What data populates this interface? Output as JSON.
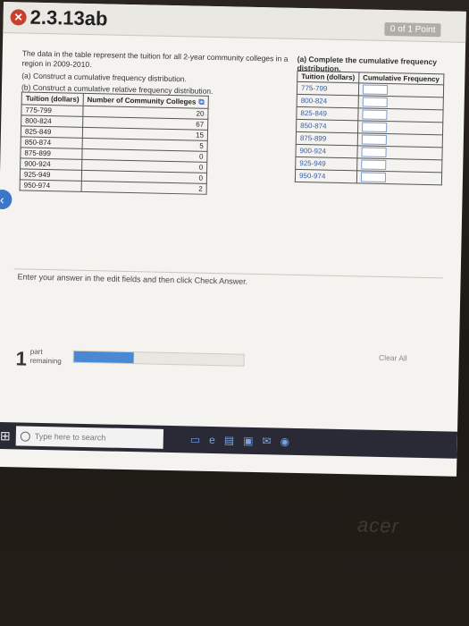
{
  "header": {
    "title": "2.3.13ab",
    "points": "0 of 1 Point"
  },
  "problem": {
    "intro": "The data in the table represent the tuition for all 2-year community colleges in a region in 2009-2010.",
    "part_a": "(a) Construct a cumulative frequency distribution.",
    "part_b": "(b) Construct a cumulative relative frequency distribution."
  },
  "source_table": {
    "col1_header": "Tuition (dollars)",
    "col2_header": "Number of Community Colleges",
    "rows": [
      {
        "range": "775-799",
        "count": "20"
      },
      {
        "range": "800-824",
        "count": "67"
      },
      {
        "range": "825-849",
        "count": "15"
      },
      {
        "range": "850-874",
        "count": "5"
      },
      {
        "range": "875-899",
        "count": "0"
      },
      {
        "range": "900-924",
        "count": "0"
      },
      {
        "range": "925-949",
        "count": "0"
      },
      {
        "range": "950-974",
        "count": "2"
      }
    ]
  },
  "answer": {
    "prompt": "(a) Complete the cumulative frequency distribution.",
    "col1_header": "Tuition (dollars)",
    "col2_header": "Cumulative Frequency",
    "rows": [
      "775-799",
      "800-824",
      "825-849",
      "850-874",
      "875-899",
      "900-924",
      "925-949",
      "950-974"
    ]
  },
  "instructions": "Enter your answer in the edit fields and then click Check Answer.",
  "footer": {
    "part_number": "1",
    "part_label_1": "part",
    "part_label_2": "remaining",
    "progress": 0.35,
    "clear_all": "Clear All"
  },
  "taskbar": {
    "search_placeholder": "Type here to search"
  },
  "brand": "acer"
}
